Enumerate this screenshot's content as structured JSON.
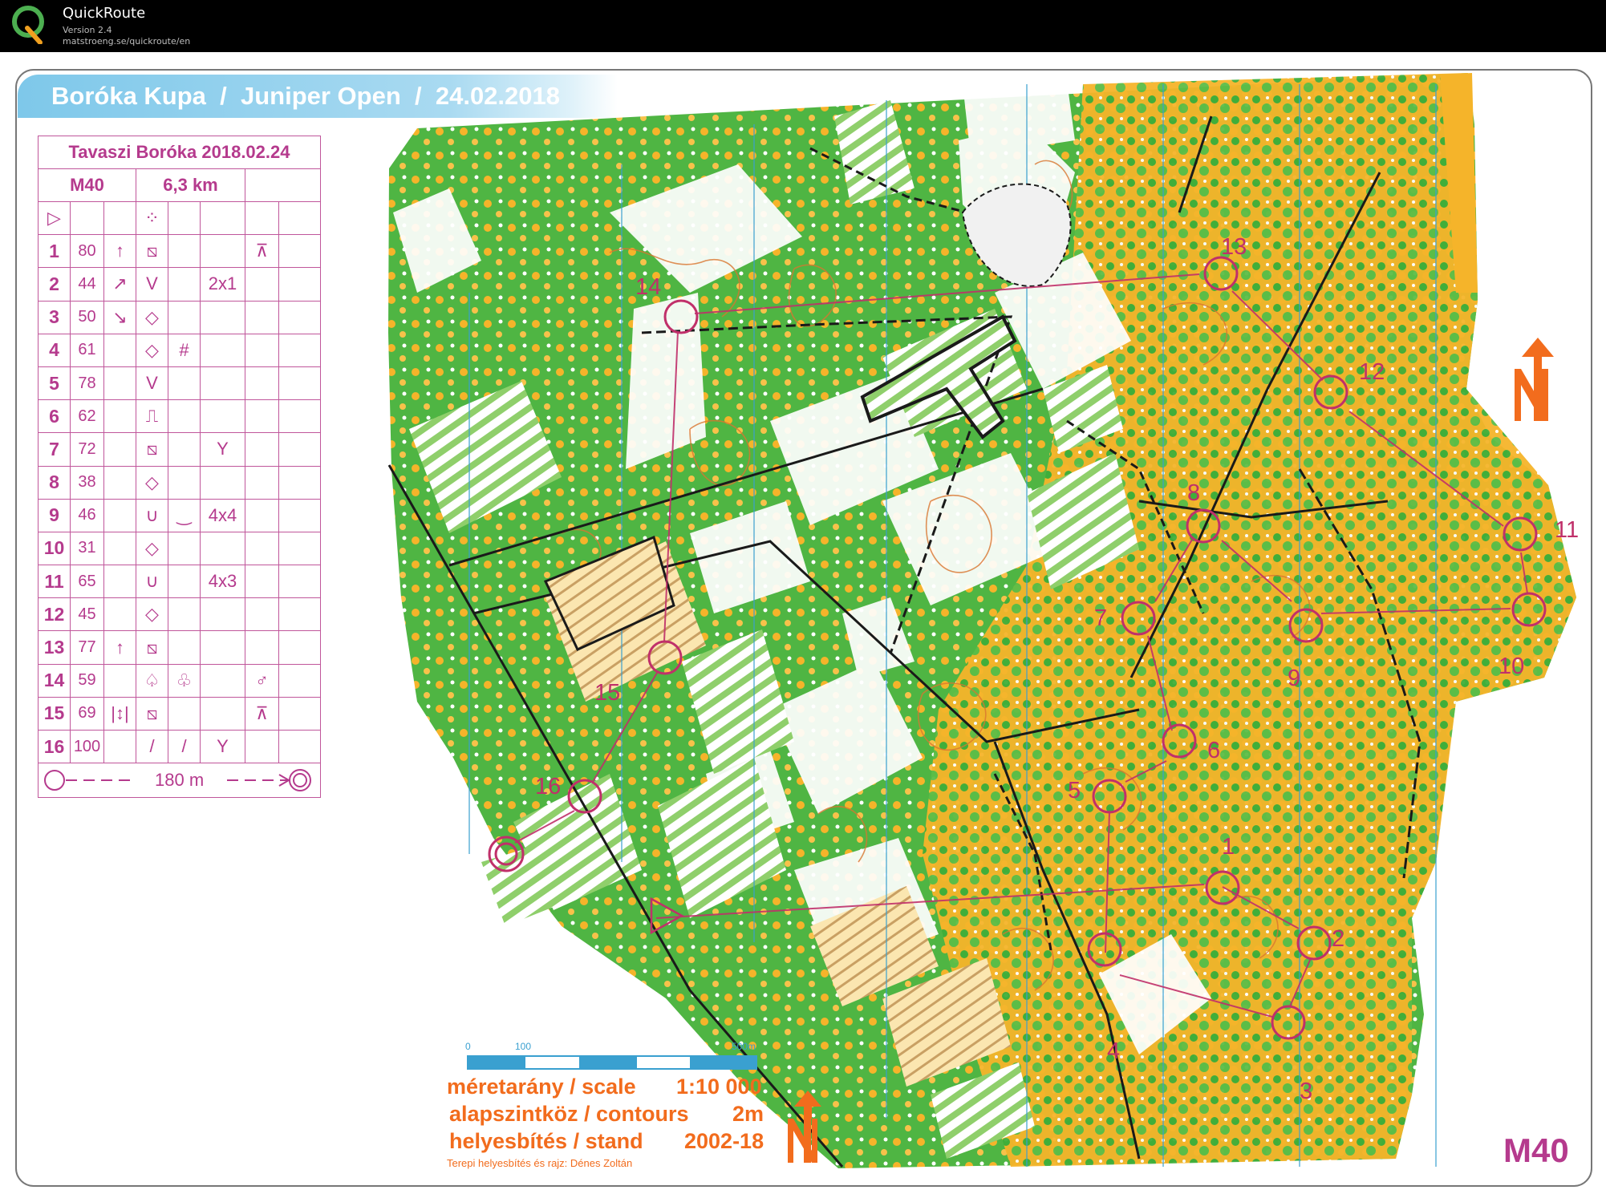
{
  "app": {
    "title": "QuickRoute",
    "version": "Version 2.4",
    "url": "matstroeng.se/quickroute/en"
  },
  "event_banner": "Boróka Kupa  /  Juniper Open  /  24.02.2018",
  "control_descriptions": {
    "event": "Tavaszi Boróka 2018.02.24",
    "course": "M40",
    "length": "6,3 km",
    "start": {
      "symbol": "▷",
      "feature": "⁘"
    },
    "rows": [
      {
        "num": "1",
        "code": "80",
        "c": "↑",
        "d": "⧅",
        "e": "",
        "f": "",
        "g": "⊼",
        "h": ""
      },
      {
        "num": "2",
        "code": "44",
        "c": "↗",
        "d": "V",
        "e": "",
        "f": "2x1",
        "g": "",
        "h": ""
      },
      {
        "num": "3",
        "code": "50",
        "c": "↘",
        "d": "◇",
        "e": "",
        "f": "",
        "g": "",
        "h": ""
      },
      {
        "num": "4",
        "code": "61",
        "c": "",
        "d": "◇",
        "e": "#",
        "f": "",
        "g": "",
        "h": ""
      },
      {
        "num": "5",
        "code": "78",
        "c": "",
        "d": "V",
        "e": "",
        "f": "",
        "g": "",
        "h": ""
      },
      {
        "num": "6",
        "code": "62",
        "c": "",
        "d": "⎍",
        "e": "",
        "f": "",
        "g": "",
        "h": ""
      },
      {
        "num": "7",
        "code": "72",
        "c": "",
        "d": "⧅",
        "e": "",
        "f": "Y",
        "g": "",
        "h": ""
      },
      {
        "num": "8",
        "code": "38",
        "c": "",
        "d": "◇",
        "e": "",
        "f": "",
        "g": "",
        "h": ""
      },
      {
        "num": "9",
        "code": "46",
        "c": "",
        "d": "∪",
        "e": "‿",
        "f": "4x4",
        "g": "",
        "h": ""
      },
      {
        "num": "10",
        "code": "31",
        "c": "",
        "d": "◇",
        "e": "",
        "f": "",
        "g": "",
        "h": ""
      },
      {
        "num": "11",
        "code": "65",
        "c": "",
        "d": "∪",
        "e": "",
        "f": "4x3",
        "g": "",
        "h": ""
      },
      {
        "num": "12",
        "code": "45",
        "c": "",
        "d": "◇",
        "e": "",
        "f": "",
        "g": "",
        "h": ""
      },
      {
        "num": "13",
        "code": "77",
        "c": "↑",
        "d": "⧅",
        "e": "",
        "f": "",
        "g": "",
        "h": ""
      },
      {
        "num": "14",
        "code": "59",
        "c": "",
        "d": "♤",
        "e": "♧",
        "f": "",
        "g": "♂",
        "h": ""
      },
      {
        "num": "15",
        "code": "69",
        "c": "|↕|",
        "d": "⧅",
        "e": "",
        "f": "",
        "g": "⊼",
        "h": ""
      },
      {
        "num": "16",
        "code": "100",
        "c": "",
        "d": "/",
        "e": "/",
        "f": "Y",
        "g": "",
        "h": ""
      }
    ],
    "finish_distance": "180 m"
  },
  "scale_bar": {
    "ticks": [
      "0",
      "100",
      "500m"
    ]
  },
  "legend": {
    "scale_label": "méretarány / scale",
    "scale_value": "1:10 000",
    "contours_label": "alapszintköz / contours",
    "contours_value": "2m",
    "stand_label": "helyesbítés / stand",
    "stand_value": "2002-18",
    "mapper": "Terepi helyesbítés és rajz: Dénes Zoltán"
  },
  "class_label": "M40",
  "course": {
    "start": "start-triangle",
    "controls": [
      {
        "label": "1"
      },
      {
        "label": "2"
      },
      {
        "label": "3"
      },
      {
        "label": "4"
      },
      {
        "label": "5"
      },
      {
        "label": "6"
      },
      {
        "label": "7"
      },
      {
        "label": "8"
      },
      {
        "label": "9"
      },
      {
        "label": "10"
      },
      {
        "label": "11"
      },
      {
        "label": "12"
      },
      {
        "label": "13"
      },
      {
        "label": "14"
      },
      {
        "label": "15"
      },
      {
        "label": "16"
      }
    ],
    "finish": "finish-double-circle"
  },
  "colors": {
    "forest_green": "#3fae3a",
    "light_green": "#8fcf6b",
    "open_yellow": "#f5b42a",
    "course_magenta": "#c0306a",
    "contour_brown": "#d9762f",
    "banner_blue": "#7ec8ea",
    "legend_orange": "#f26c1d"
  },
  "icons": [
    "quickroute-logo-icon",
    "north-arrow-icon"
  ]
}
